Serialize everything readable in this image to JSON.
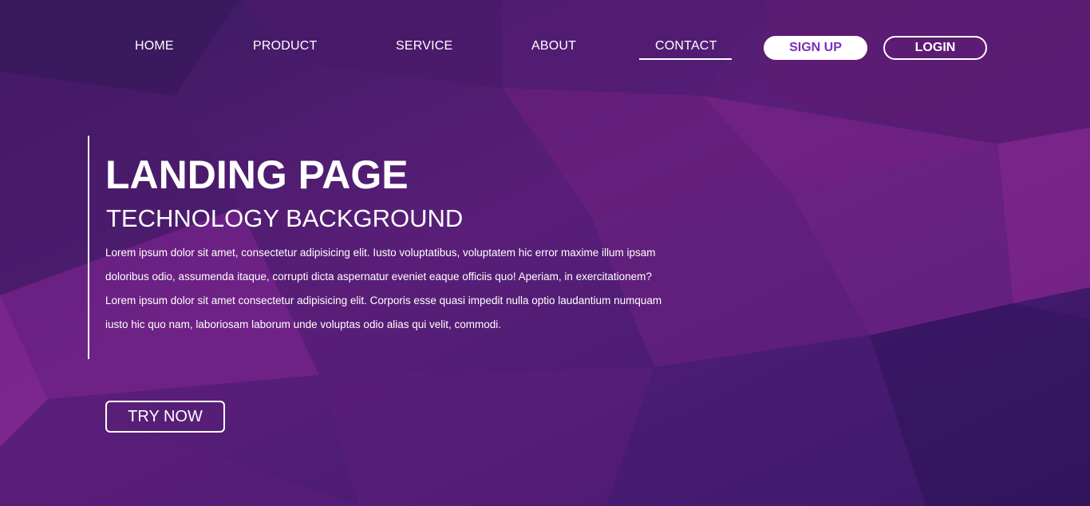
{
  "nav": {
    "items": [
      {
        "label": "HOME"
      },
      {
        "label": "PRODUCT"
      },
      {
        "label": "SERVICE"
      },
      {
        "label": "ABOUT"
      },
      {
        "label": "CONTACT"
      }
    ],
    "active": "CONTACT",
    "signup_label": "SIGN UP",
    "login_label": "LOGIN"
  },
  "hero": {
    "title": "LANDING PAGE",
    "subtitle": "TECHNOLOGY BACKGROUND",
    "body": "Lorem ipsum dolor sit amet, consectetur adipisicing elit. Iusto voluptatibus, voluptatem hic error maxime illum ipsam doloribus odio, assumenda itaque, corrupti dicta aspernatur eveniet eaque officiis quo! Aperiam, in exercitationem? Lorem ipsum dolor sit amet consectetur adipisicing elit. Corporis esse quasi impedit nulla optio laudantium numquam iusto hic quo nam, laboriosam laborum unde voluptas odio alias qui velit, commodi.",
    "cta_label": "TRY NOW"
  },
  "colors": {
    "background_dark": "#3a1658",
    "background_magenta": "#8a2a96",
    "accent": "#7a30b8",
    "text": "#ffffff"
  }
}
